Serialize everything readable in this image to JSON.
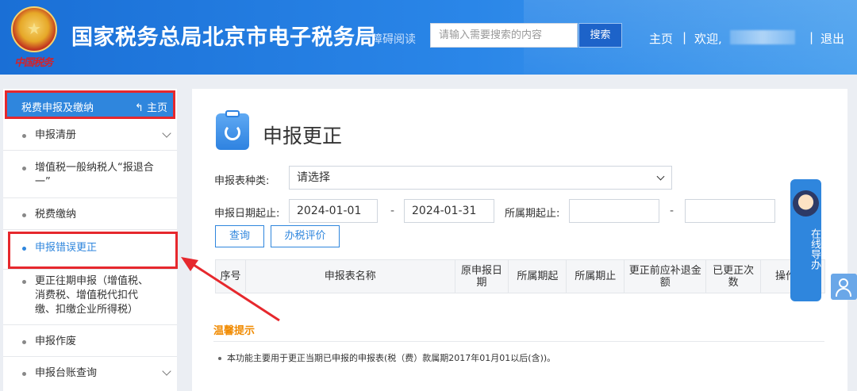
{
  "header": {
    "title": "国家税务总局北京市电子税务局",
    "seal_text": "中国税务",
    "read_link": "障碍阅读",
    "search_placeholder": "请输入需要搜索的内容",
    "search_button": "搜索",
    "home": "主页",
    "separator": "|",
    "welcome": "欢迎,",
    "logout": "退出"
  },
  "sidebar": {
    "section_title": "税费申报及缴纳",
    "home_link": "主页",
    "items": [
      {
        "label": "申报清册",
        "has_chevron": true
      },
      {
        "label": "增值税一般纳税人“报退合一”",
        "has_chevron": false
      },
      {
        "label": "税费缴纳",
        "has_chevron": false
      },
      {
        "label": "申报错误更正",
        "has_chevron": false,
        "active": true
      },
      {
        "label": "更正往期申报（增值税、消费税、增值税代扣代缴、扣缴企业所得税）",
        "has_chevron": false
      },
      {
        "label": "申报作废",
        "has_chevron": false
      },
      {
        "label": "申报台账查询",
        "has_chevron": true
      }
    ]
  },
  "main": {
    "page_title": "申报更正",
    "form": {
      "type_label": "申报表种类:",
      "type_value": "请选择",
      "date_label": "申报日期起止:",
      "date_start": "2024-01-01",
      "date_sep": "-",
      "date_end": "2024-01-31",
      "period_label": "所属期起止:",
      "period_start": "",
      "period_end": "",
      "query_button": "查询",
      "rate_button": "办税评价"
    },
    "table_headers": [
      "序号",
      "申报表名称",
      "原申报日期",
      "所属期起",
      "所属期止",
      "更正前应补退金额",
      "已更正次数",
      "操作"
    ],
    "tips_title": "温馨提示",
    "tips": [
      "本功能主要用于更正当期已申报的申报表(税（费）款属期2017年01月01以后(含))。"
    ]
  },
  "guide": {
    "label": "在线导办"
  },
  "colors": {
    "accent": "#2f86dd",
    "highlight": "#e6282d",
    "tips": "#f08a00"
  }
}
